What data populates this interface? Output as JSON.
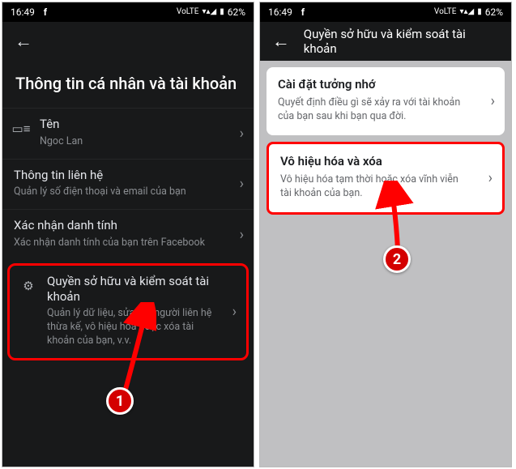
{
  "status": {
    "time": "16:49",
    "battery_pct": "62%",
    "logo": "f",
    "signals": "▾▴◢",
    "lte": "VoLTE"
  },
  "left": {
    "heading": "Thông tin cá nhân và tài khoản",
    "rows": {
      "name": {
        "title": "Tên",
        "sub": "Ngoc Lan"
      },
      "contact": {
        "title": "Thông tin liên hệ",
        "sub": "Quản lý số điện thoại và email của bạn"
      },
      "identity": {
        "title": "Xác nhận danh tính",
        "sub": "Xác nhận danh tính của bạn trên Facebook"
      },
      "ownership": {
        "title": "Quyền sở hữu và kiểm soát tài khoản",
        "sub": "Quản lý dữ liệu, sửa đổi người liên hệ thừa kế, vô hiệu hóa hoặc xóa tài khoản của bạn, v.v."
      }
    }
  },
  "right": {
    "header_title": "Quyền sở hữu và kiểm soát tài khoản",
    "cards": {
      "memorial": {
        "title": "Cài đặt tưởng nhớ",
        "sub": "Quyết định điều gì sẽ xảy ra với tài khoản của bạn sau khi bạn qua đời."
      },
      "deactivate": {
        "title": "Vô hiệu hóa và xóa",
        "sub": "Vô hiệu hóa tạm thời hoặc xóa vĩnh viễn tài khoản của bạn."
      }
    }
  },
  "annotations": {
    "badge1": "1",
    "badge2": "2"
  }
}
